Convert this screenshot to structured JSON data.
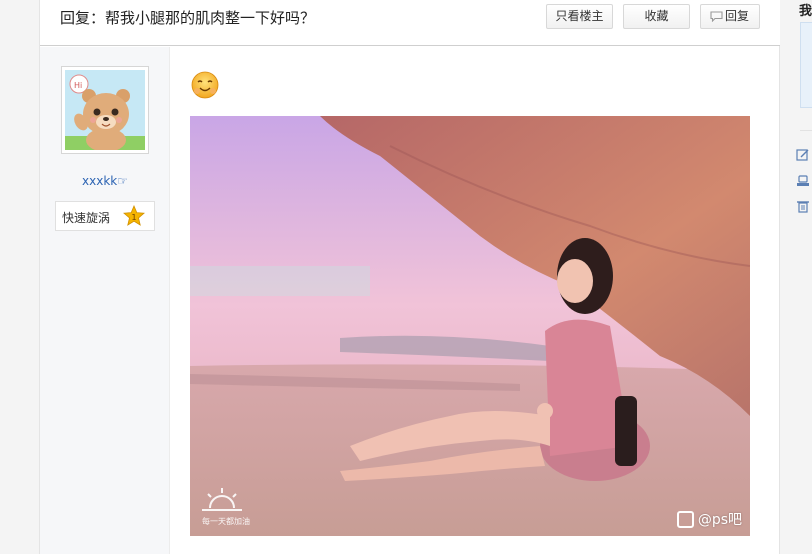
{
  "header": {
    "title": "回复：帮我小腿那的肌肉整一下好吗？",
    "only_op_label": "只看楼主",
    "favorite_label": "收藏",
    "reply_label": "回复"
  },
  "author": {
    "username": "xxxkk☞",
    "badge_label": "快速旋涡",
    "badge_level": "1"
  },
  "post": {
    "emoji": "smiling-face-emoji",
    "photo_watermark_left": "每一天都加油",
    "photo_watermark_right": "@ps吧"
  },
  "sidebar": {
    "title": "我"
  },
  "colors": {
    "link_blue": "#2d64b3",
    "badge_star": "#f5b400"
  }
}
